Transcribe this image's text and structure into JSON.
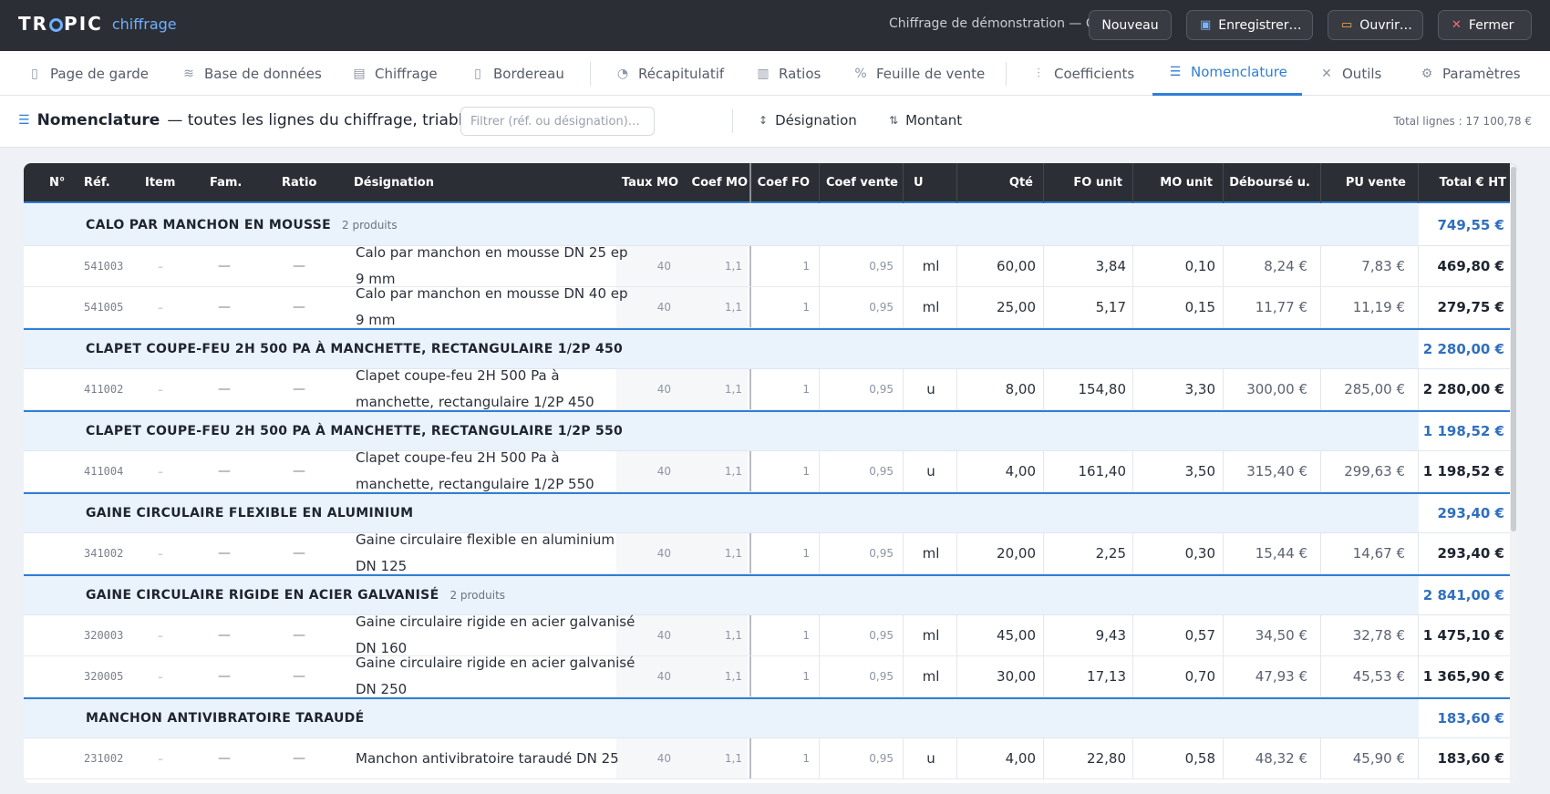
{
  "app": {
    "brand_main": "TR",
    "brand_o": "O",
    "brand_rest": "PIC",
    "brand_sub": "chiffrage",
    "document": "Chiffrage de démonstration — CVC"
  },
  "topbar": {
    "nouveau": "Nouveau",
    "enregistrer": "Enregistrer…",
    "ouvrir": "Ouvrir…",
    "fermer": "Fermer"
  },
  "tabs": [
    {
      "label": "Page de garde",
      "icon": "file-icon"
    },
    {
      "label": "Base de données",
      "icon": "database-icon"
    },
    {
      "label": "Chiffrage",
      "icon": "clipboard-icon"
    },
    {
      "label": "Bordereau",
      "icon": "document-icon"
    },
    {
      "label": "Récapitulatif",
      "icon": "pie-icon"
    },
    {
      "label": "Ratios",
      "icon": "bars-icon"
    },
    {
      "label": "Feuille de vente",
      "icon": "percent-icon"
    },
    {
      "label": "Coefficients",
      "icon": "sliders-icon"
    },
    {
      "label": "Nomenclature",
      "icon": "list-icon",
      "active": true
    },
    {
      "label": "Outils",
      "icon": "tools-icon"
    },
    {
      "label": "Paramètres",
      "icon": "gear-icon"
    }
  ],
  "toolbar": {
    "title": "Nomenclature",
    "subtitle": "— toutes les lignes du chiffrage, triables",
    "filter_placeholder": "Filtrer (réf. ou désignation)…",
    "sort_designation": "Désignation",
    "sort_montant": "Montant",
    "total_lines": "Total lignes : 17 100,78 €"
  },
  "columns": [
    "N°",
    "Réf.",
    "Item",
    "Fam.",
    "Ratio",
    "Désignation",
    "Taux MO",
    "Coef MO",
    "Coef FO",
    "Coef vente",
    "U",
    "Qté",
    "FO unit",
    "MO unit",
    "Déboursé u.",
    "PU vente",
    "Total € HT"
  ],
  "groups": [
    {
      "name": "CALO PAR MANCHON EN MOUSSE",
      "count": "2 produits",
      "total": "749,55 €",
      "rows": [
        {
          "ref": "541003",
          "item": "–",
          "fam": "—",
          "ratio": "—",
          "designation": "Calo par manchon en mousse DN 25 ep 9 mm",
          "taux_mo": "40",
          "coef_mo": "1,1",
          "coef_fo": "1",
          "coef_vente": "0,95",
          "u": "ml",
          "qte": "60,00",
          "fo_unit": "3,84",
          "mo_unit": "0,10",
          "debourse": "8,24 €",
          "pu_vente": "7,83 €",
          "total": "469,80 €"
        },
        {
          "ref": "541005",
          "item": "–",
          "fam": "—",
          "ratio": "—",
          "designation": "Calo par manchon en mousse DN 40 ep 9 mm",
          "taux_mo": "40",
          "coef_mo": "1,1",
          "coef_fo": "1",
          "coef_vente": "0,95",
          "u": "ml",
          "qte": "25,00",
          "fo_unit": "5,17",
          "mo_unit": "0,15",
          "debourse": "11,77 €",
          "pu_vente": "11,19 €",
          "total": "279,75 €"
        }
      ]
    },
    {
      "name": "CLAPET COUPE-FEU 2H 500 PA À MANCHETTE, RECTANGULAIRE 1/2P 450",
      "count": "",
      "total": "2 280,00 €",
      "rows": [
        {
          "ref": "411002",
          "item": "–",
          "fam": "—",
          "ratio": "—",
          "designation": "Clapet coupe-feu 2H 500 Pa à manchette, rectangulaire 1/2P 450",
          "taux_mo": "40",
          "coef_mo": "1,1",
          "coef_fo": "1",
          "coef_vente": "0,95",
          "u": "u",
          "qte": "8,00",
          "fo_unit": "154,80",
          "mo_unit": "3,30",
          "debourse": "300,00 €",
          "pu_vente": "285,00 €",
          "total": "2 280,00 €"
        }
      ]
    },
    {
      "name": "CLAPET COUPE-FEU 2H 500 PA À MANCHETTE, RECTANGULAIRE 1/2P 550",
      "count": "",
      "total": "1 198,52 €",
      "rows": [
        {
          "ref": "411004",
          "item": "–",
          "fam": "—",
          "ratio": "—",
          "designation": "Clapet coupe-feu 2H 500 Pa à manchette, rectangulaire 1/2P 550",
          "taux_mo": "40",
          "coef_mo": "1,1",
          "coef_fo": "1",
          "coef_vente": "0,95",
          "u": "u",
          "qte": "4,00",
          "fo_unit": "161,40",
          "mo_unit": "3,50",
          "debourse": "315,40 €",
          "pu_vente": "299,63 €",
          "total": "1 198,52 €"
        }
      ]
    },
    {
      "name": "GAINE CIRCULAIRE FLEXIBLE EN ALUMINIUM",
      "count": "",
      "total": "293,40 €",
      "rows": [
        {
          "ref": "341002",
          "item": "–",
          "fam": "—",
          "ratio": "—",
          "designation": "Gaine circulaire flexible en aluminium DN 125",
          "taux_mo": "40",
          "coef_mo": "1,1",
          "coef_fo": "1",
          "coef_vente": "0,95",
          "u": "ml",
          "qte": "20,00",
          "fo_unit": "2,25",
          "mo_unit": "0,30",
          "debourse": "15,44 €",
          "pu_vente": "14,67 €",
          "total": "293,40 €"
        }
      ]
    },
    {
      "name": "GAINE CIRCULAIRE RIGIDE EN ACIER GALVANISÉ",
      "count": "2 produits",
      "total": "2 841,00 €",
      "rows": [
        {
          "ref": "320003",
          "item": "–",
          "fam": "—",
          "ratio": "—",
          "designation": "Gaine circulaire rigide en acier galvanisé DN 160",
          "taux_mo": "40",
          "coef_mo": "1,1",
          "coef_fo": "1",
          "coef_vente": "0,95",
          "u": "ml",
          "qte": "45,00",
          "fo_unit": "9,43",
          "mo_unit": "0,57",
          "debourse": "34,50 €",
          "pu_vente": "32,78 €",
          "total": "1 475,10 €"
        },
        {
          "ref": "320005",
          "item": "–",
          "fam": "—",
          "ratio": "—",
          "designation": "Gaine circulaire rigide en acier galvanisé DN 250",
          "taux_mo": "40",
          "coef_mo": "1,1",
          "coef_fo": "1",
          "coef_vente": "0,95",
          "u": "ml",
          "qte": "30,00",
          "fo_unit": "17,13",
          "mo_unit": "0,70",
          "debourse": "47,93 €",
          "pu_vente": "45,53 €",
          "total": "1 365,90 €"
        }
      ]
    },
    {
      "name": "MANCHON ANTIVIBRATOIRE TARAUDÉ",
      "count": "",
      "total": "183,60 €",
      "rows": [
        {
          "ref": "231002",
          "item": "–",
          "fam": "—",
          "ratio": "—",
          "designation": "Manchon antivibratoire taraudé DN 25",
          "taux_mo": "40",
          "coef_mo": "1,1",
          "coef_fo": "1",
          "coef_vente": "0,95",
          "u": "u",
          "qte": "4,00",
          "fo_unit": "22,80",
          "mo_unit": "0,58",
          "debourse": "48,32 €",
          "pu_vente": "45,90 €",
          "total": "183,60 €"
        }
      ]
    }
  ],
  "colors": {
    "accent": "#2f7fd6",
    "topbar": "#2b2e35",
    "group_bg": "#eaf3fc"
  }
}
